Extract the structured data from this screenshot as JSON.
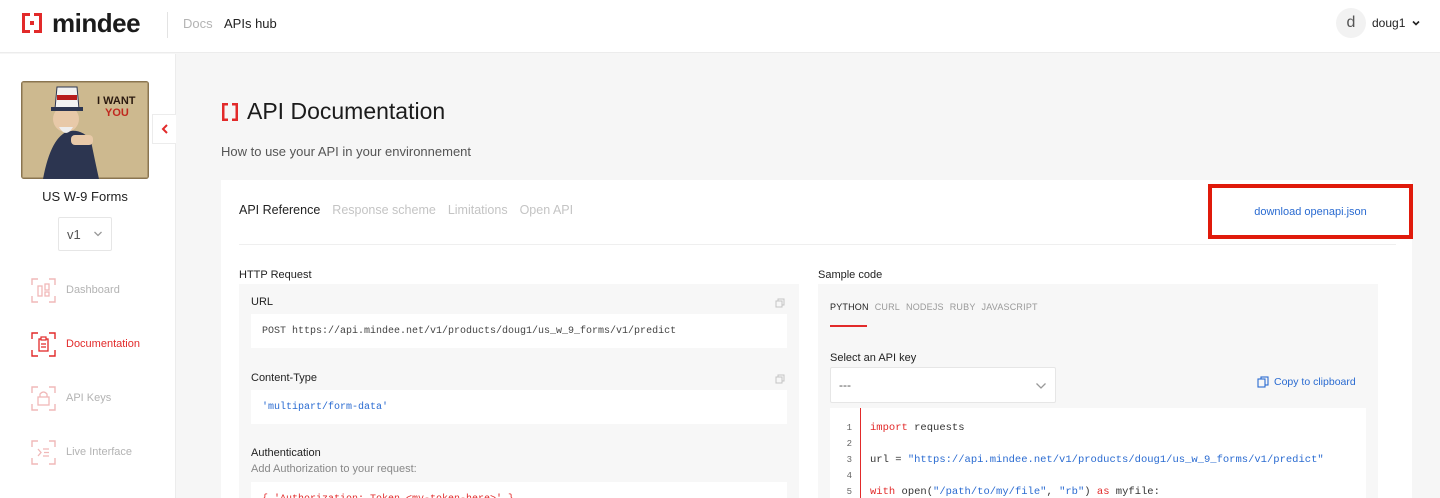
{
  "header": {
    "brand": "mindee",
    "nav": {
      "docs": "Docs",
      "apis_hub": "APIs hub"
    },
    "user": {
      "initial": "d",
      "name": "doug1"
    }
  },
  "sidebar": {
    "document_name": "US W-9 Forms",
    "thumbnail_text": {
      "line1": "I WANT",
      "line2": "YOU"
    },
    "version": "v1",
    "items": [
      {
        "label": "Dashboard",
        "icon": "dashboard-icon",
        "active": false
      },
      {
        "label": "Documentation",
        "icon": "documentation-icon",
        "active": true
      },
      {
        "label": "API Keys",
        "icon": "lock-icon",
        "active": false
      },
      {
        "label": "Live Interface",
        "icon": "live-interface-icon",
        "active": false
      }
    ]
  },
  "page": {
    "title": "API Documentation",
    "subtitle": "How to use your API in your environnement",
    "tabs": [
      {
        "label": "API Reference",
        "active": true
      },
      {
        "label": "Response scheme",
        "active": false
      },
      {
        "label": "Limitations",
        "active": false
      },
      {
        "label": "Open API",
        "active": false
      }
    ],
    "download_label": "download openapi.json"
  },
  "http_request": {
    "title": "HTTP Request",
    "url_label": "URL",
    "url_value": "POST https://api.mindee.net/v1/products/doug1/us_w_9_forms/v1/predict",
    "content_type_label": "Content-Type",
    "content_type_value": "'multipart/form-data'",
    "auth_label": "Authentication",
    "auth_hint": "Add Authorization to your request:",
    "auth_value": "{ 'Authorization: Token <my-token-here>' }"
  },
  "sample_code": {
    "title": "Sample code",
    "languages": [
      "PYTHON",
      "CURL",
      "NODEJS",
      "RUBY",
      "JAVASCRIPT"
    ],
    "active_language": "PYTHON",
    "api_key_label": "Select an API key",
    "api_key_value": "---",
    "copy_label": "Copy to clipboard",
    "line_numbers": [
      "1",
      "2",
      "3",
      "4",
      "5"
    ],
    "line1_kw": "import",
    "line1_rest": " requests",
    "line3_pre": "url = ",
    "line3_str": "\"https://api.mindee.net/v1/products/doug1/us_w_9_forms/v1/predict\"",
    "line5_kw1": "with",
    "line5_a": " open(",
    "line5_str1": "\"/path/to/my/file\"",
    "line5_b": ", ",
    "line5_str2": "\"rb\"",
    "line5_c": ") ",
    "line5_kw2": "as",
    "line5_d": " myfile:"
  },
  "colors": {
    "accent": "#e22a2a",
    "link": "#2a6bd1",
    "highlight_box": "#e01a0b"
  }
}
